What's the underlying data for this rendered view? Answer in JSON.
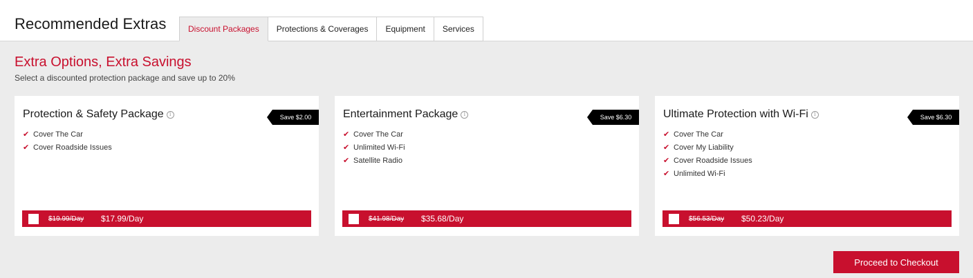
{
  "header": {
    "title": "Recommended Extras",
    "tabs": [
      {
        "label": "Discount Packages",
        "active": true
      },
      {
        "label": "Protections & Coverages",
        "active": false
      },
      {
        "label": "Equipment",
        "active": false
      },
      {
        "label": "Services",
        "active": false
      }
    ]
  },
  "main": {
    "headline": "Extra Options, Extra Savings",
    "subline": "Select a discounted protection package and save up to 20%"
  },
  "packages": [
    {
      "title": "Protection & Safety Package",
      "badge": "Save $2.00",
      "features": [
        "Cover The Car",
        "Cover Roadside Issues"
      ],
      "old_price": "$19.99/Day",
      "new_price": "$17.99/Day"
    },
    {
      "title": "Entertainment Package",
      "badge": "Save $6.30",
      "features": [
        "Cover The Car",
        "Unlimited Wi-Fi",
        "Satellite Radio"
      ],
      "old_price": "$41.98/Day",
      "new_price": "$35.68/Day"
    },
    {
      "title": "Ultimate Protection with Wi-Fi",
      "badge": "Save $6.30",
      "features": [
        "Cover The Car",
        "Cover My Liability",
        "Cover Roadside Issues",
        "Unlimited Wi-Fi"
      ],
      "old_price": "$56.53/Day",
      "new_price": "$50.23/Day"
    }
  ],
  "actions": {
    "checkout_label": "Proceed to Checkout"
  },
  "icons": {
    "check": "checkmark-icon",
    "info": "info-icon"
  },
  "colors": {
    "accent": "#c8102e",
    "background": "#ececec",
    "badge": "#000000"
  }
}
